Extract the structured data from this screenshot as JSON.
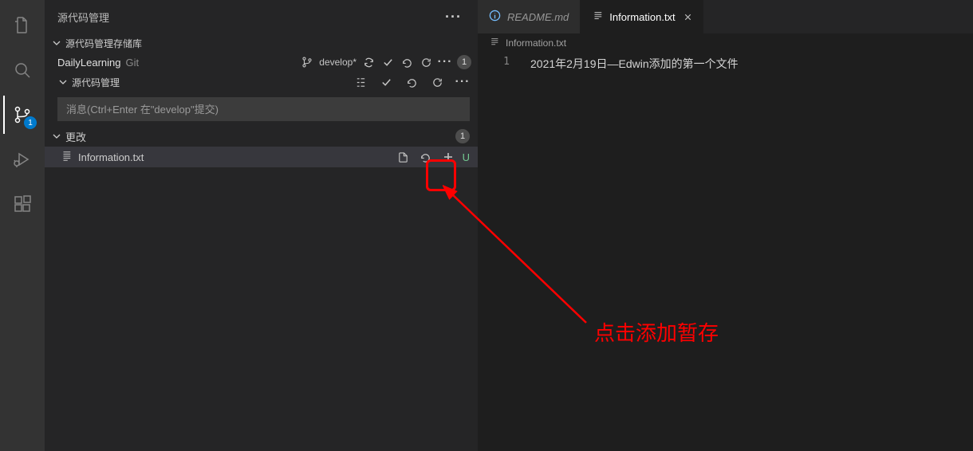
{
  "activityBar": {
    "scmBadge": "1"
  },
  "sidebar": {
    "title": "源代码管理",
    "repoSection": {
      "title": "源代码管理存储库"
    },
    "repo": {
      "name": "DailyLearning",
      "type": "Git",
      "branch": "develop*",
      "badge": "1"
    },
    "scmSection": {
      "title": "源代码管理"
    },
    "commitPlaceholder": "消息(Ctrl+Enter 在\"develop\"提交)",
    "changes": {
      "title": "更改",
      "badge": "1",
      "file": {
        "name": "Information.txt",
        "status": "U"
      }
    }
  },
  "tabs": {
    "readme": "README.md",
    "info": "Information.txt"
  },
  "breadcrumb": {
    "file": "Information.txt"
  },
  "editor": {
    "lineNumber": "1",
    "line1": "2021年2月19日—Edwin添加的第一个文件"
  },
  "annotation": {
    "text": "点击添加暂存"
  }
}
